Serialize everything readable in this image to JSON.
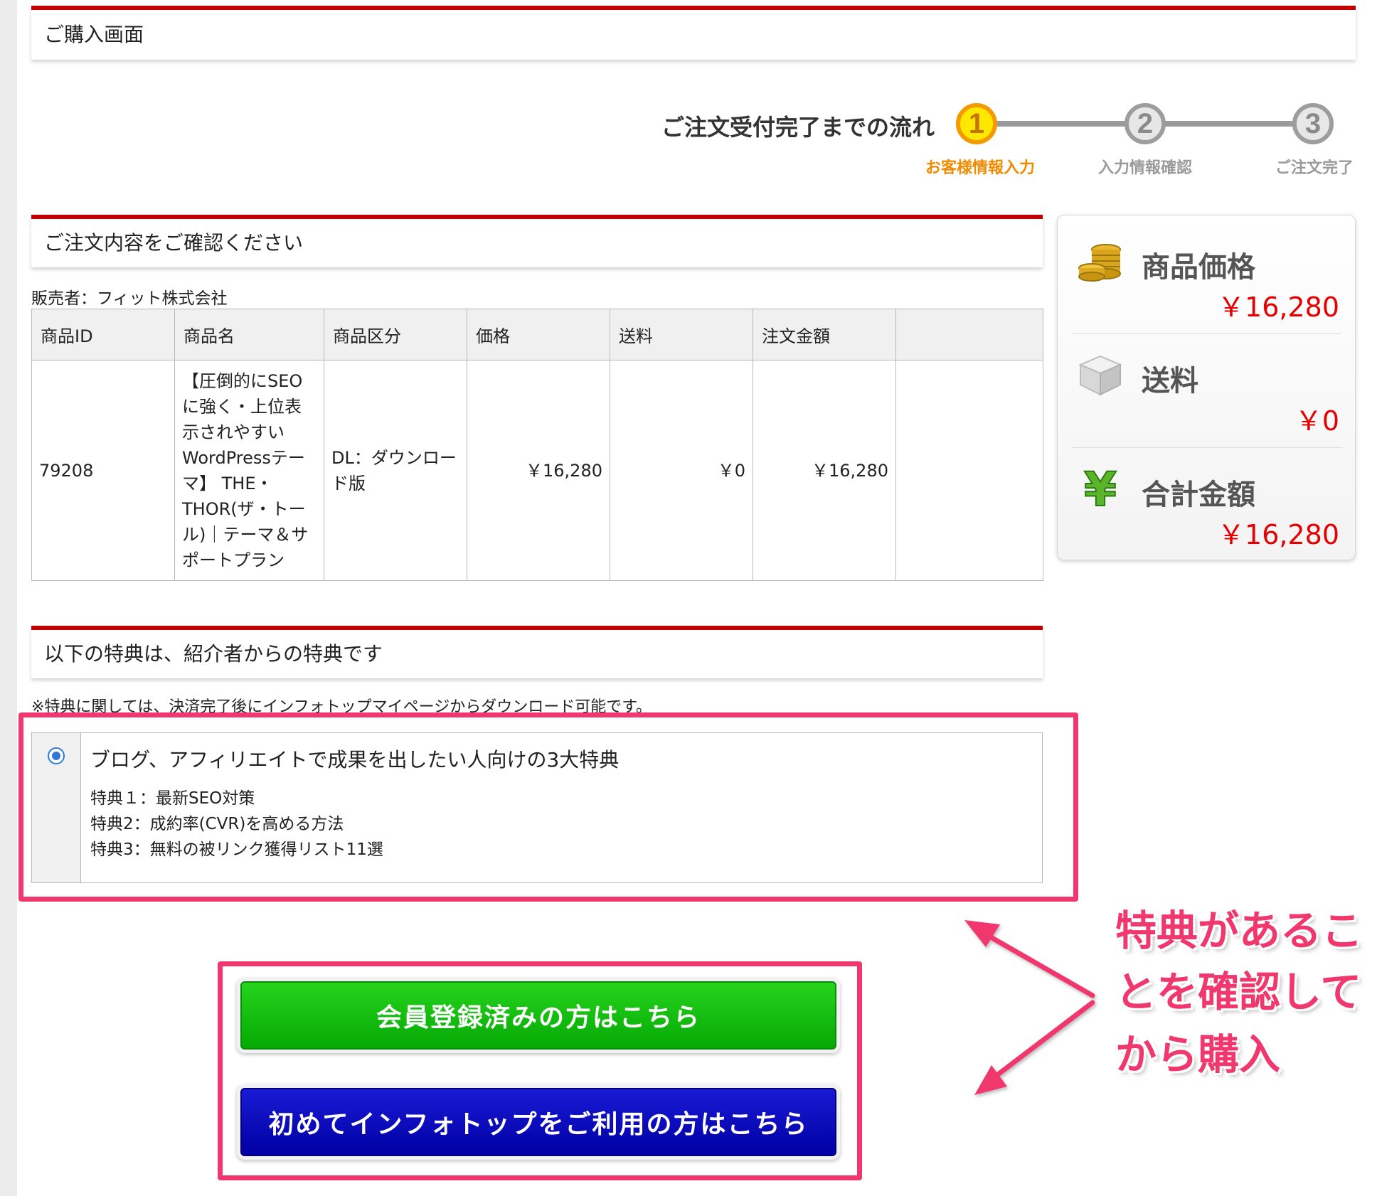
{
  "page": {
    "title": "ご購入画面"
  },
  "flow": {
    "label": "ご注文受付完了までの流れ",
    "steps": [
      {
        "num": "1",
        "label": "お客様情報入力",
        "active": true
      },
      {
        "num": "2",
        "label": "入力情報確認",
        "active": false
      },
      {
        "num": "3",
        "label": "ご注文完了",
        "active": false
      }
    ]
  },
  "order": {
    "header": "ご注文内容をご確認ください",
    "seller": "販売者：フィット株式会社",
    "columns": [
      "商品ID",
      "商品名",
      "商品区分",
      "価格",
      "送料",
      "注文金額",
      ""
    ],
    "row": {
      "id": "79208",
      "name_lines": [
        "【圧倒的にSEO",
        "に強く・上位表",
        "示されやすい",
        "WordPressテー",
        "マ】 THE・",
        "THOR(ザ・トー",
        "ル)｜テーマ＆サ",
        "ポートプラン"
      ],
      "category_lines": [
        "DL：ダウンロー",
        "ド版"
      ],
      "price": "￥16,280",
      "shipping": "￥0",
      "total": "￥16,280"
    }
  },
  "summary": {
    "price_label": "商品価格",
    "price_value": "￥16,280",
    "shipping_label": "送料",
    "shipping_value": "￥0",
    "total_label": "合計金額",
    "total_value": "￥16,280",
    "icons": [
      "coins-icon",
      "box-icon",
      "yen-icon"
    ]
  },
  "bonus": {
    "header": "以下の特典は、紹介者からの特典です",
    "note": "※特典に関しては、決済完了後にインフォトップマイページからダウンロード可能です。",
    "title": "ブログ、アフィリエイトで成果を出したい人向けの3大特典",
    "items": [
      "特典１：最新SEO対策",
      "特典2：成約率(CVR)を高める方法",
      "特典3：無料の被リンク獲得リスト11選"
    ],
    "selected": true
  },
  "buttons": {
    "member": "会員登録済みの方はこちら",
    "first_time": "初めてインフォトップをご利用の方はこちら"
  },
  "annotation": {
    "lines": [
      "特典があるこ",
      "とを確認して",
      "から購入"
    ]
  },
  "colors": {
    "accent_red": "#c00000",
    "highlight_pink": "#f0386e",
    "green_button": "#05a904",
    "blue_button": "#0000a3",
    "price_red": "#e60000",
    "active_step": "#ffe800"
  }
}
